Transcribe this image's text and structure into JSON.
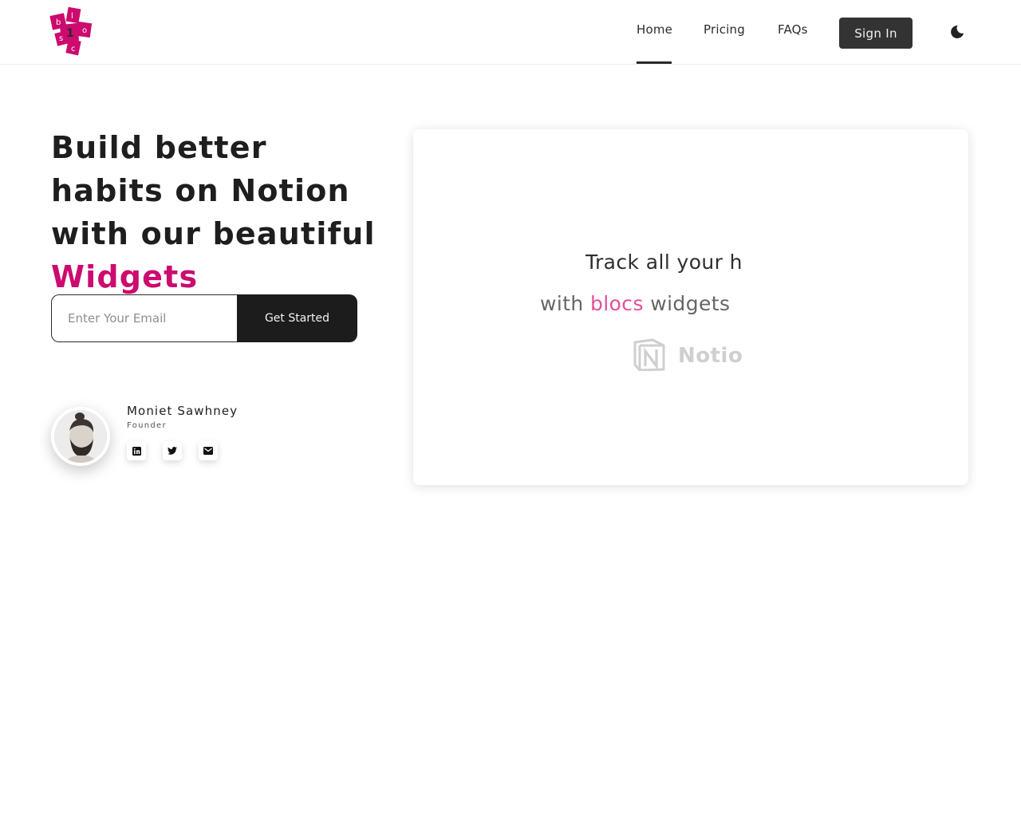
{
  "header": {
    "logo_letters": [
      "b",
      "l",
      "o",
      "c",
      "s"
    ],
    "nav": [
      {
        "label": "Home",
        "active": true
      },
      {
        "label": "Pricing",
        "active": false
      },
      {
        "label": "FAQs",
        "active": false
      }
    ],
    "signin_label": "Sign In",
    "theme_icon": "moon-icon"
  },
  "hero": {
    "title_main": "Build better habits on Notion with our beautiful ",
    "title_accent": "Widgets",
    "email_placeholder": "Enter Your Email",
    "cta_label": "Get Started"
  },
  "founder": {
    "name": "Moniet Sawhney",
    "role": "Founder",
    "socials": [
      "linkedin-icon",
      "twitter-icon",
      "mail-icon"
    ]
  },
  "preview": {
    "line1": "Track all your h",
    "line2_pre": "with ",
    "line2_accent": "blocs",
    "line2_post": " widgets",
    "notion_label": "Notion"
  },
  "colors": {
    "accent": "#cc0a6f",
    "preview_accent": "#e0509a",
    "signin_bg": "#333333",
    "cta_bg": "#1c1c1c"
  }
}
